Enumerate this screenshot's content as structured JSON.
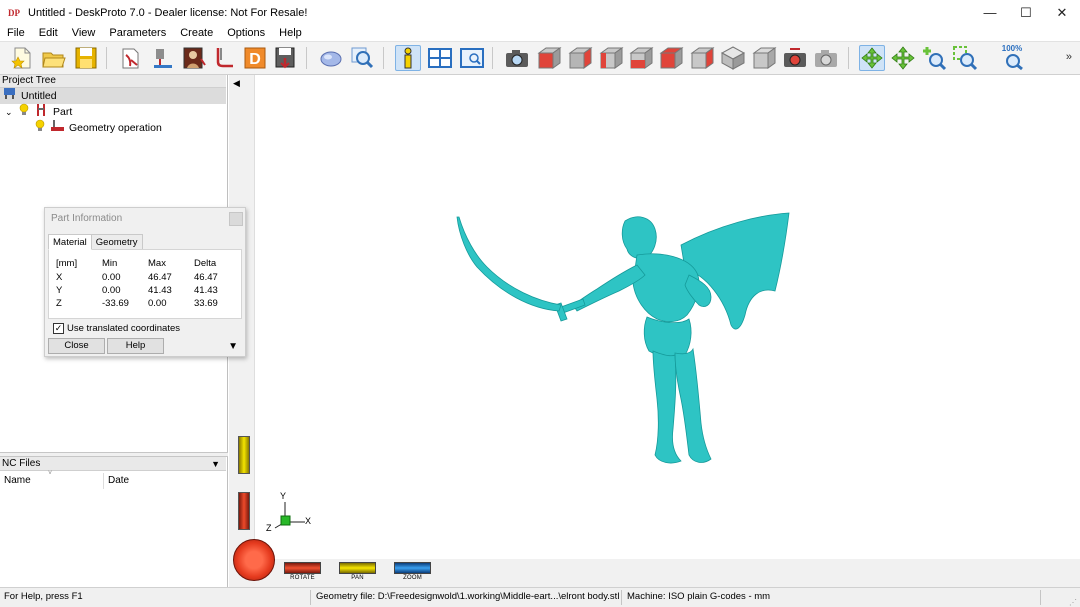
{
  "window": {
    "title": "Untitled - DeskProto 7.0 - Dealer license: Not For Resale!",
    "icon_text": "DP",
    "minimize": "—",
    "maximize": "☐",
    "close": "✕"
  },
  "menu": [
    "File",
    "Edit",
    "View",
    "Parameters",
    "Create",
    "Options",
    "Help"
  ],
  "toolbar": {
    "zoom_percent": "100%",
    "overflow": "»",
    "buttons": [
      "new-file-icon",
      "open-folder-icon",
      "save-icon",
      "import-geometry-icon",
      "part-to-machine-icon",
      "bitmap-icon",
      "vector-icon",
      "dwg-icon",
      "save-nc-icon",
      "shaded-view-icon",
      "zoom-window-icon",
      "info-icon",
      "tile-view-icon",
      "screen-view-icon",
      "camera-icon",
      "view-front-icon",
      "view-back-icon",
      "view-left-icon",
      "view-right-icon",
      "view-top-icon",
      "view-bottom-icon",
      "view-iso-a-icon",
      "view-iso-b-icon",
      "render-icon",
      "capture-icon",
      "rotate-icon",
      "pan-icon",
      "zoom-in-icon",
      "zoom-box-icon",
      "zoom-100-icon"
    ],
    "accent_selected": "#cfe3f7"
  },
  "project_tree": {
    "header": "Project Tree",
    "items": [
      {
        "label": "Untitled"
      },
      {
        "label": "Part"
      },
      {
        "label": "Geometry operation"
      }
    ]
  },
  "nc_files": {
    "header": "NC Files",
    "columns": [
      "Name",
      "Date"
    ]
  },
  "part_info": {
    "title": "Part Information",
    "tabs": [
      "Material",
      "Geometry"
    ],
    "columns": [
      "[mm]",
      "Min",
      "Max",
      "Delta"
    ],
    "rows": [
      {
        "axis": "X",
        "min": "0.00",
        "max": "46.47",
        "delta": "46.47"
      },
      {
        "axis": "Y",
        "min": "0.00",
        "max": "41.43",
        "delta": "41.43"
      },
      {
        "axis": "Z",
        "min": "-33.69",
        "max": "0.00",
        "delta": "33.69"
      }
    ],
    "checkbox_label": "Use translated coordinates",
    "checkbox_checked": true,
    "close_label": "Close",
    "help_label": "Help"
  },
  "viewport": {
    "model_color": "#2ec4c4",
    "axes": {
      "x": "X",
      "y": "Y",
      "z": "Z"
    },
    "sliders": {
      "rotate": "ROTATE",
      "pan": "PAN",
      "zoom": "ZOOM"
    }
  },
  "status": {
    "help": "For Help, press F1",
    "geometry_file": "Geometry file: D:\\Freedesignwold\\1.working\\Middle-eart...\\elront body.stl",
    "machine": "Machine: ISO plain G-codes - mm"
  }
}
